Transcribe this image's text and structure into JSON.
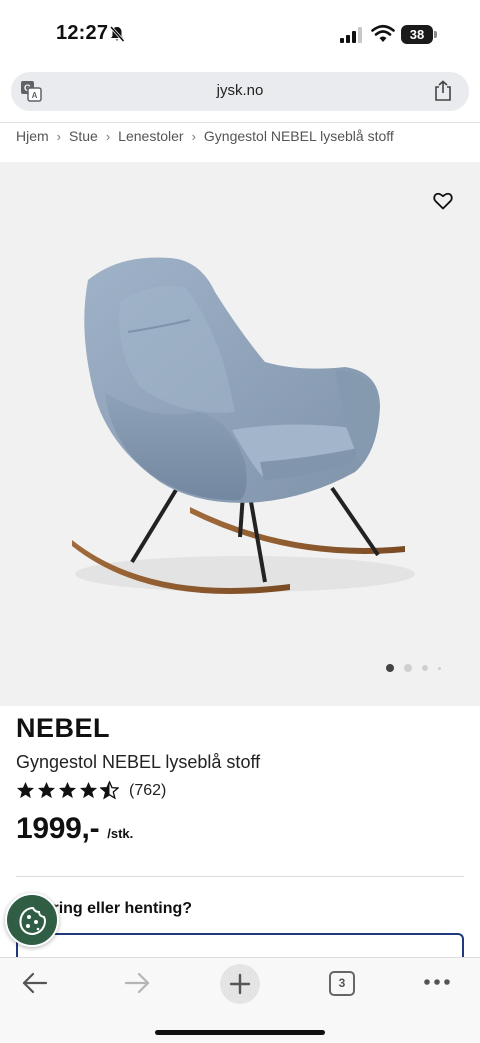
{
  "status": {
    "time": "12:27",
    "battery": "38"
  },
  "browser": {
    "url": "jysk.no",
    "tab_count": "3"
  },
  "breadcrumb": [
    "Hjem",
    "Stue",
    "Lenestoler",
    "Gyngestol NEBEL lyseblå stoff"
  ],
  "gallery": {
    "image_count": 4,
    "active_index": 0
  },
  "product": {
    "name": "NEBEL",
    "description": "Gyngestol NEBEL lyseblå stoff",
    "rating": 4.5,
    "reviews": "(762)",
    "price": "1999,-",
    "unit": "/stk."
  },
  "delivery": {
    "heading": "Levering eller henting?"
  },
  "colors": {
    "accent_blue": "#1e3a7a",
    "cookie_green": "#2f5e45"
  }
}
